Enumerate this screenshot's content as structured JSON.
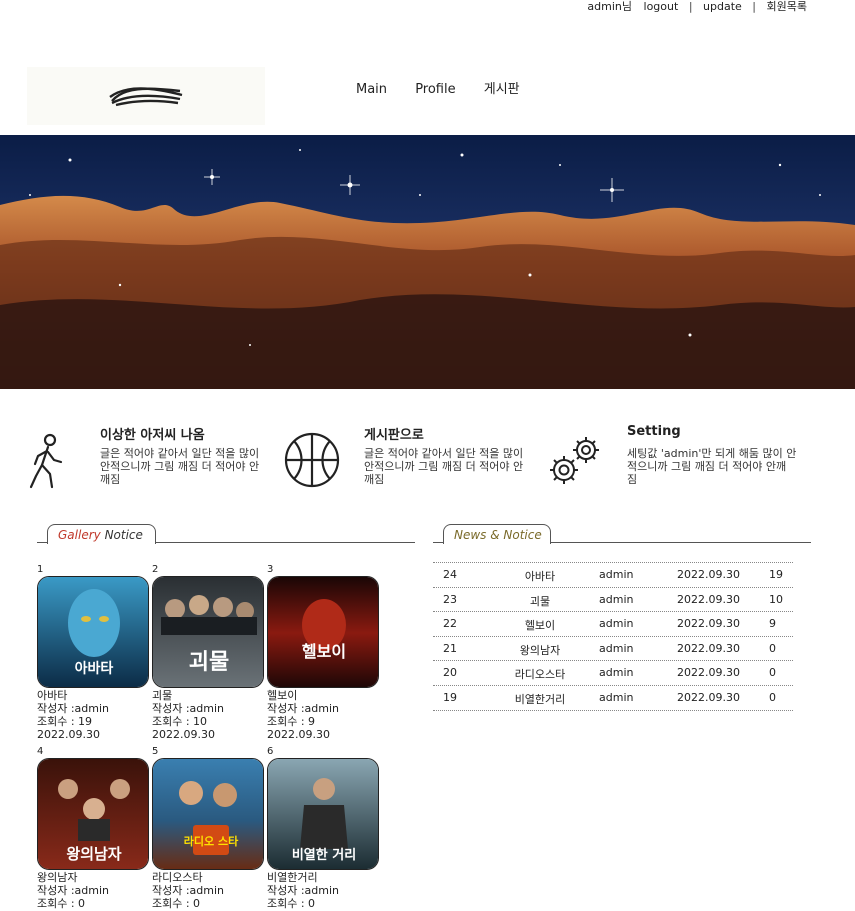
{
  "top_nav": {
    "greeting_name": "admin",
    "greeting_suffix": "님",
    "logout": "logout",
    "update": "update",
    "members": "회원목록",
    "separator": "|"
  },
  "main_menu": [
    {
      "label": "Main"
    },
    {
      "label": "Profile"
    },
    {
      "label": "게시판"
    }
  ],
  "features": [
    {
      "icon": "walking-person-icon",
      "title": "이상한 아저씨 나옴",
      "text": "글은 적어야 같아서 일단 적을 많이 안적으니까 그림 깨짐 더 적어야 안 깨짐"
    },
    {
      "icon": "basketball-icon",
      "title": "게시판으로",
      "text": "글은 적어야 같아서 일단 적을 많이 안적으니까 그림 깨짐 더 적어야 안 깨짐"
    },
    {
      "icon": "gears-icon",
      "title": "Setting",
      "text": "세팅값 'admin'만 되게 해둠 많이 안 적으니까 그림 깨짐 더 적어야 안깨 짐"
    }
  ],
  "gallery_tab": {
    "word1": "Gallery",
    "word2": "Notice",
    "accent": "#c0392b"
  },
  "news_tab": {
    "label": "News & Notice",
    "accent": "#7a6a2a"
  },
  "gallery": {
    "items": [
      {
        "num": "1",
        "title": "아바타",
        "author": "작성자 :admin",
        "views": "조회수 : 19",
        "date": "2022.09.30",
        "poster_text": "아바타",
        "poster_colors": [
          "#2d7fa8",
          "#0b2a44"
        ]
      },
      {
        "num": "2",
        "title": "괴물",
        "author": "작성자 :admin",
        "views": "조회수 : 10",
        "date": "2022.09.30",
        "poster_text": "괴물",
        "poster_colors": [
          "#6b7378",
          "#1d2226"
        ]
      },
      {
        "num": "3",
        "title": "헬보이",
        "author": "작성자 :admin",
        "views": "조회수 : 9",
        "date": "2022.09.30",
        "poster_text": "헬보이",
        "poster_colors": [
          "#7a1010",
          "#1a0606"
        ]
      },
      {
        "num": "4",
        "title": "왕의남자",
        "author": "작성자 :admin",
        "views": "조회수 : 0",
        "date": "",
        "poster_text": "왕의남자",
        "poster_colors": [
          "#8a2a1a",
          "#2a0e08"
        ]
      },
      {
        "num": "5",
        "title": "라디오스타",
        "author": "작성자 :admin",
        "views": "조회수 : 0",
        "date": "",
        "poster_text": "라디오 스타",
        "poster_colors": [
          "#3a7fb0",
          "#c75a1a"
        ]
      },
      {
        "num": "6",
        "title": "비열한거리",
        "author": "작성자 :admin",
        "views": "조회수 : 0",
        "date": "",
        "poster_text": "비열한 거리",
        "poster_colors": [
          "#5a7a8a",
          "#1a2a30"
        ]
      }
    ]
  },
  "news": {
    "rows": [
      {
        "no": "24",
        "title": "아바타",
        "author": "admin",
        "date": "2022.09.30",
        "views": "19"
      },
      {
        "no": "23",
        "title": "괴물",
        "author": "admin",
        "date": "2022.09.30",
        "views": "10"
      },
      {
        "no": "22",
        "title": "헬보이",
        "author": "admin",
        "date": "2022.09.30",
        "views": "9"
      },
      {
        "no": "21",
        "title": "왕의남자",
        "author": "admin",
        "date": "2022.09.30",
        "views": "0"
      },
      {
        "no": "20",
        "title": "라디오스타",
        "author": "admin",
        "date": "2022.09.30",
        "views": "0"
      },
      {
        "no": "19",
        "title": "비열한거리",
        "author": "admin",
        "date": "2022.09.30",
        "views": "0"
      }
    ]
  },
  "hero": {
    "sky_color": "#0a1a3a",
    "cloud_color": "#b8602a"
  }
}
